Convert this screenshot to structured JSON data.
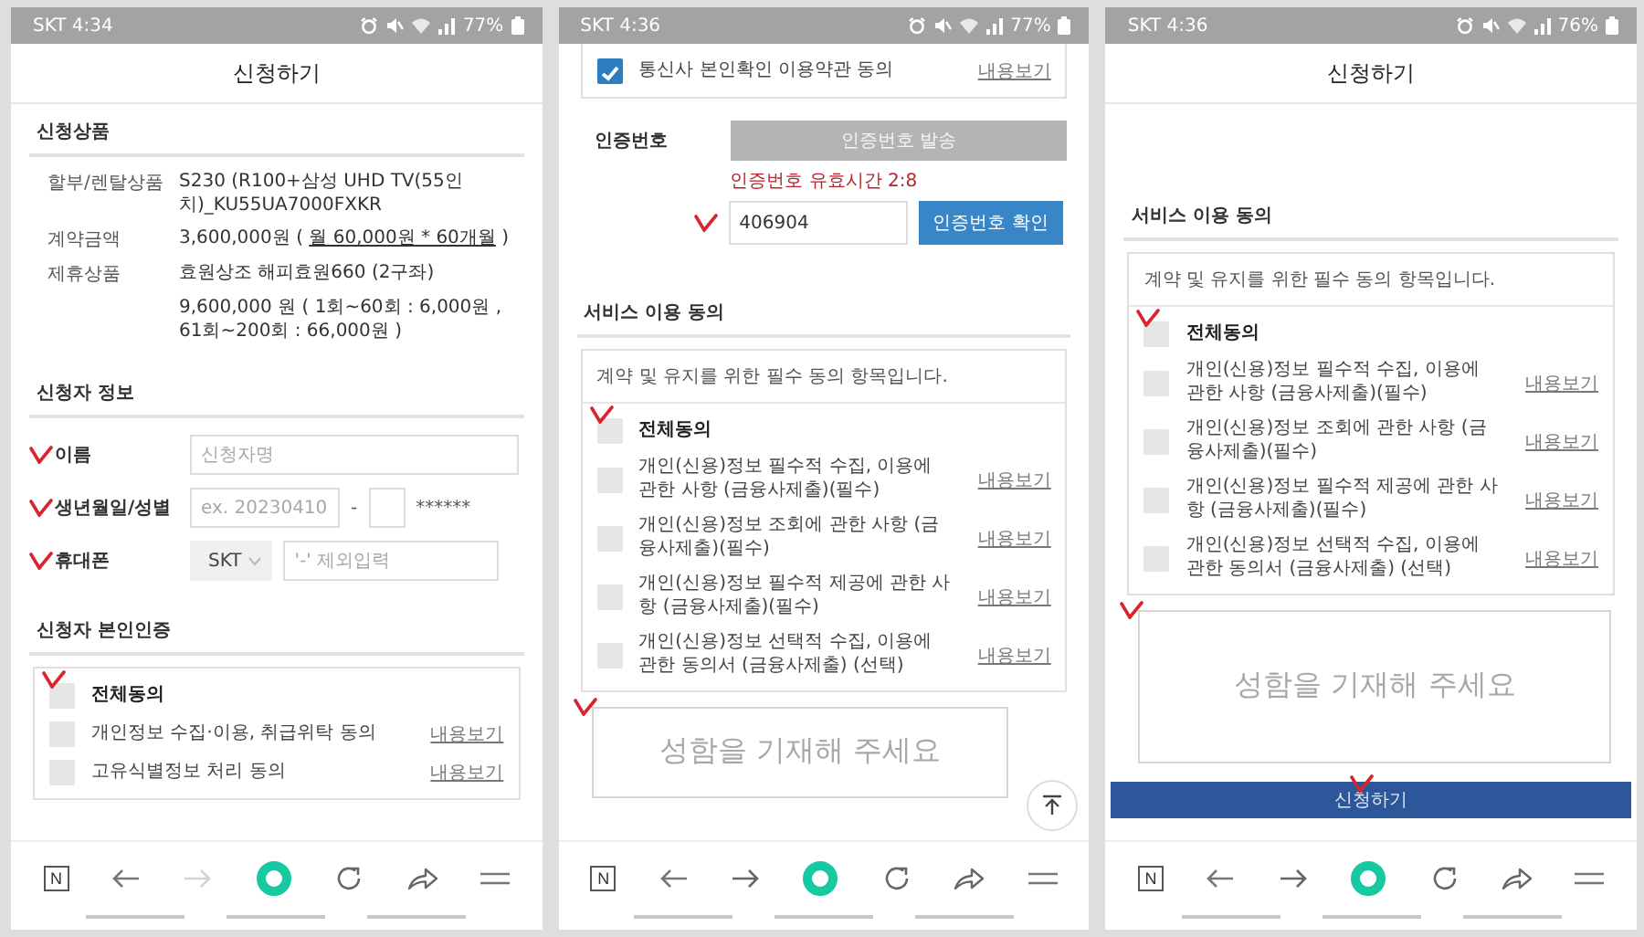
{
  "screens": [
    {
      "status_bar": {
        "text": "SKT 4:34",
        "battery": "77%"
      },
      "header": {
        "title": "신청하기"
      },
      "sections": [
        {
          "kind": "product",
          "title": "신청상품",
          "rows": [
            {
              "label": "할부/렌탈상품",
              "value": "S230 (R100+삼성 UHD TV(55인치)_KU55UA7000FXKR"
            },
            {
              "label": "계약금액",
              "value": "3,600,000원 (",
              "underlined": "월 60,000원 * 60개월",
              "value_end": ")"
            },
            {
              "label": "제휴상품",
              "value": "효원상조 해피효원660 (2구좌)"
            },
            {
              "value": "9,600,000 원 ( 1회~60회 : 6,000원 , 61회~200회 : 66,000원 )"
            }
          ]
        },
        {
          "kind": "form",
          "title": "신청자 정보",
          "fields": [
            {
              "kind": "text",
              "label": "이름",
              "placeholder": "신청자명",
              "annotated": true
            },
            {
              "kind": "birth",
              "label": "생년월일/성별",
              "placeholder": "ex. 20230410",
              "separator": "-",
              "mask": "******",
              "annotated": true
            },
            {
              "kind": "phone",
              "label": "휴대폰",
              "carrier": "SKT",
              "placeholder": "'-' 제외입력",
              "annotated": true
            }
          ]
        },
        {
          "kind": "consent",
          "title": "신청자 본인인증",
          "items": [
            {
              "label": "전체동의",
              "all": true,
              "checked": false,
              "annotated": true
            },
            {
              "label": "개인정보 수집·이용, 취급위탁 동의",
              "link": "내용보기",
              "all": false,
              "checked": false,
              "annotated": false
            },
            {
              "label": "고유식별정보 처리 동의",
              "link": "내용보기",
              "all": false,
              "checked": false,
              "annotated": false
            }
          ]
        }
      ],
      "toolbar": {
        "logo": "N",
        "forward_enabled": false
      }
    },
    {
      "status_bar": {
        "text": "SKT 4:36",
        "battery": "77%"
      },
      "sections": [
        {
          "kind": "consent",
          "items": [
            {
              "label": "통신사 본인확인 이용약관 동의",
              "link": "내용보기",
              "all": false,
              "checked": true,
              "annotated": false
            }
          ]
        },
        {
          "kind": "auth",
          "label": "인증번호",
          "send_button": "인증번호 발송",
          "timer": "인증번호 유효시간 2:8",
          "value": "406904",
          "confirm_button": "인증번호 확인",
          "annotated": true
        },
        {
          "kind": "consent",
          "title": "서비스 이용 동의",
          "note": "계약 및 유지를 위한 필수 동의 항목입니다.",
          "items": [
            {
              "label": "전체동의",
              "all": true,
              "checked": false,
              "annotated": true
            },
            {
              "label": "개인(신용)정보 필수적 수집, 이용에 관한 사항 (금융사제출)(필수)",
              "link": "내용보기",
              "all": false,
              "checked": false,
              "annotated": false
            },
            {
              "label": "개인(신용)정보 조회에 관한 사항 (금융사제출)(필수)",
              "link": "내용보기",
              "all": false,
              "checked": false,
              "annotated": false
            },
            {
              "label": "개인(신용)정보 필수적 제공에 관한 사항 (금융사제출)(필수)",
              "link": "내용보기",
              "all": false,
              "checked": false,
              "annotated": false
            },
            {
              "label": "개인(신용)정보 선택적 수집, 이용에 관한 동의서 (금융사제출) (선택)",
              "link": "내용보기",
              "all": false,
              "checked": false,
              "annotated": false
            }
          ]
        },
        {
          "kind": "signature",
          "placeholder": "성함을 기재해 주세요",
          "annotated": true
        }
      ],
      "scroll_top_button": true,
      "toolbar": {
        "logo": "N",
        "forward_enabled": true
      }
    },
    {
      "status_bar": {
        "text": "SKT 4:36",
        "battery": "76%"
      },
      "header": {
        "title": "신청하기"
      },
      "sections": [
        {
          "kind": "consent",
          "title": "서비스 이용 동의",
          "spaced": true,
          "note": "계약 및 유지를 위한 필수 동의 항목입니다.",
          "items": [
            {
              "label": "전체동의",
              "all": true,
              "checked": false,
              "annotated": true
            },
            {
              "label": "개인(신용)정보 필수적 수집, 이용에 관한 사항 (금융사제출)(필수)",
              "link": "내용보기",
              "all": false,
              "checked": false,
              "annotated": false
            },
            {
              "label": "개인(신용)정보 조회에 관한 사항 (금융사제출)(필수)",
              "link": "내용보기",
              "all": false,
              "checked": false,
              "annotated": false
            },
            {
              "label": "개인(신용)정보 필수적 제공에 관한 사항 (금융사제출)(필수)",
              "link": "내용보기",
              "all": false,
              "checked": false,
              "annotated": false
            },
            {
              "label": "개인(신용)정보 선택적 수집, 이용에 관한 동의서 (금융사제출) (선택)",
              "link": "내용보기",
              "all": false,
              "checked": false,
              "annotated": false
            }
          ]
        },
        {
          "kind": "signature",
          "placeholder": "성함을 기재해 주세요",
          "annotated": true
        },
        {
          "kind": "submit",
          "label": "신청하기",
          "annotated": true
        }
      ],
      "toolbar": {
        "logo": "N",
        "forward_enabled": true
      }
    }
  ]
}
